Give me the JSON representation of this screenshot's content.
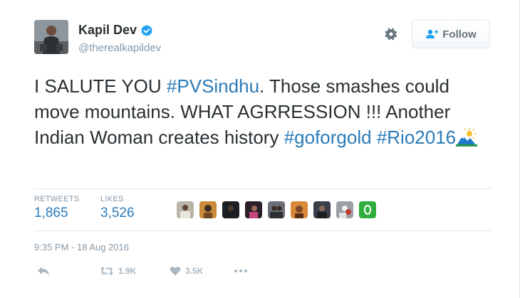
{
  "user": {
    "name": "Kapil Dev",
    "handle": "@therealkapildev",
    "avatar_icon": "user-avatar"
  },
  "header": {
    "follow_label": "Follow",
    "settings_icon": "gear-icon",
    "follow_icon": "add-user-icon"
  },
  "tweet": {
    "part1": "I SALUTE YOU ",
    "hashtag1": "#PVSindhu",
    "part2": ". Those smashes could move mountains. WHAT AGRRESSION !!! Another Indian Woman creates history ",
    "hashtag2": "#goforgold",
    "space": " ",
    "hashtag3": "#Rio2016",
    "emoji_icon": "sunrise-over-mountains-icon"
  },
  "stats": {
    "retweets_label": "RETWEETS",
    "retweets_value": "1,865",
    "likes_label": "LIKES",
    "likes_value": "3,526"
  },
  "likers_count_shown": 9,
  "timestamp": "9:35 PM - 18 Aug 2016",
  "actions": {
    "reply_icon": "reply-icon",
    "retweet_icon": "retweet-icon",
    "retweet_count": "1.9K",
    "like_icon": "heart-icon",
    "like_count": "3.5K",
    "more_icon": "more-dots-icon"
  },
  "colors": {
    "link": "#2b7bb9",
    "muted": "#8899a6",
    "text": "#292f33",
    "verified": "#1da1f2"
  }
}
